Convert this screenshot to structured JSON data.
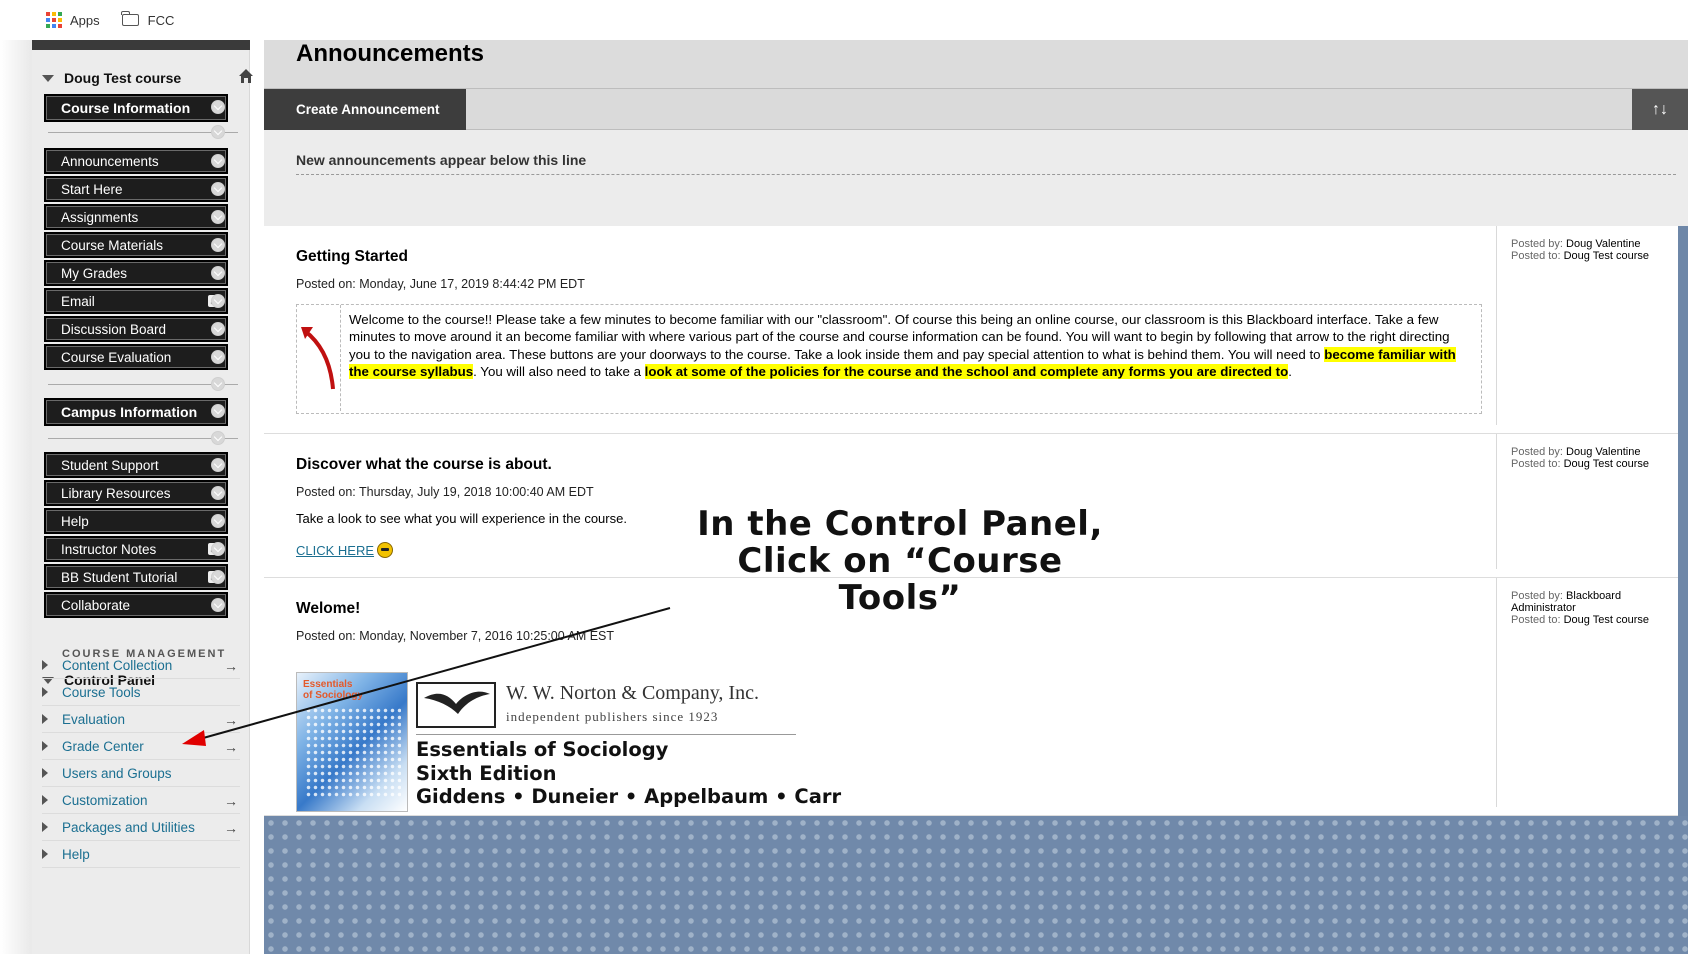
{
  "bookmarks": [
    {
      "label": "Apps",
      "icon": "apps-grid-icon"
    },
    {
      "label": "FCC",
      "icon": "folder-icon"
    }
  ],
  "sidebar": {
    "course_title": "Doug Test course",
    "nav": [
      {
        "label": "Course Information",
        "type": "header"
      },
      {
        "label": "Announcements"
      },
      {
        "label": "Start Here"
      },
      {
        "label": "Assignments"
      },
      {
        "label": "Course Materials"
      },
      {
        "label": "My Grades"
      },
      {
        "label": "Email",
        "has_link_icon": true
      },
      {
        "label": "Discussion Board"
      },
      {
        "label": "Course Evaluation"
      },
      {
        "label": "Campus Information",
        "type": "header"
      },
      {
        "label": "Student Support"
      },
      {
        "label": "Library Resources"
      },
      {
        "label": "Help"
      },
      {
        "label": "Instructor Notes",
        "has_link_icon": true
      },
      {
        "label": "BB Student Tutorial",
        "has_link_icon": true
      },
      {
        "label": "Collaborate"
      }
    ],
    "course_management_label": "COURSE MANAGEMENT",
    "control_panel": {
      "title": "Control Panel",
      "items": [
        {
          "label": "Content Collection",
          "arrow": "→"
        },
        {
          "label": "Course Tools",
          "arrow": ""
        },
        {
          "label": "Evaluation",
          "arrow": "→"
        },
        {
          "label": "Grade Center",
          "arrow": "→"
        },
        {
          "label": "Users and Groups",
          "arrow": ""
        },
        {
          "label": "Customization",
          "arrow": "→"
        },
        {
          "label": "Packages and Utilities",
          "arrow": "→"
        },
        {
          "label": "Help",
          "arrow": ""
        }
      ]
    }
  },
  "main": {
    "page_title": "Announcements",
    "create_button": "Create Announcement",
    "sort_icon": "↑↓",
    "new_line_text": "New announcements appear below this line",
    "announcements": [
      {
        "title": "Getting Started",
        "posted_on": "Posted on: Monday, June 17, 2019 8:44:42 PM EDT",
        "posted_by_label": "Posted by:",
        "posted_by": "Doug Valentine",
        "posted_to_label": "Posted to:",
        "posted_to": "Doug Test course",
        "body_part1": "Welcome to the course!! Please take a few minutes to become familiar with our \"classroom\". Of course this being an online course, our classroom is this Blackboard interface. Take a few minutes to move around it an become familiar with where various part of the course and course information can be found. You will want to begin by following that arrow to the right directing you to the navigation area. These buttons are your doorways to the course. Take a look inside them and pay special attention to what is behind them. You will need to ",
        "body_hl1": "become familiar with the course syllabus",
        "body_part2": ". You will also need to take a ",
        "body_hl2": "look at some of the policies for the course and the school and complete any forms you are directed to",
        "body_part3": "."
      },
      {
        "title": "Discover what the course is about.",
        "posted_on": "Posted on: Thursday, July 19, 2018 10:00:40 AM EDT",
        "posted_by_label": "Posted by:",
        "posted_by": "Doug Valentine",
        "posted_to_label": "Posted to:",
        "posted_to": "Doug Test course",
        "body": "Take a look to see what you will experience in the course.",
        "link": "CLICK HERE"
      },
      {
        "title": "Welome!",
        "posted_on": "Posted on: Monday, November 7, 2016 10:25:00 AM EST",
        "posted_by_label": "Posted by:",
        "posted_by": "Blackboard Administrator",
        "posted_to_label": "Posted to:",
        "posted_to": "Doug Test course",
        "book": {
          "cover_title": "Essentials of Sociology",
          "publisher": "W. W. Norton & Company, Inc.",
          "publisher_tagline": "independent publishers since 1923",
          "title": "Essentials of Sociology",
          "edition": "Sixth Edition",
          "authors": "Giddens • Duneier • Appelbaum • Carr"
        }
      }
    ]
  },
  "overlay": {
    "line1": "In the Control Panel,",
    "line2": "Click on “Course Tools”",
    "arrow_color": "#e00000"
  }
}
